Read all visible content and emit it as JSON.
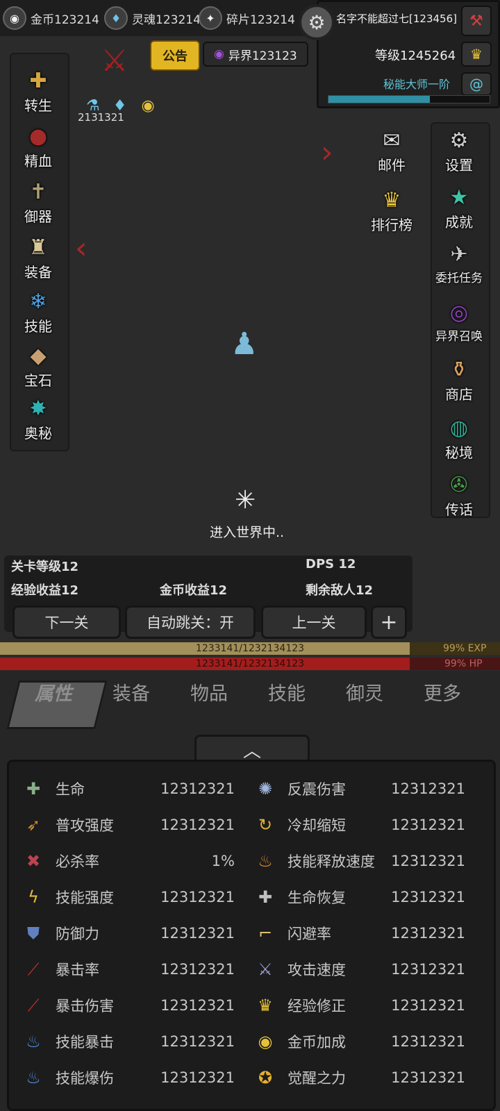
{
  "topbar": {
    "gold_label": "金币123214",
    "soul_label": "灵魂123214",
    "shard_label": "碎片123214",
    "player_name": "名字不能超过七[123456]",
    "level": "等级1245264",
    "title": "秘能大师一阶"
  },
  "notice": {
    "label": "公告",
    "other_world": "异界123123"
  },
  "buff_value": "2131321",
  "left_menu": [
    "转生",
    "精血",
    "御器",
    "装备",
    "技能",
    "宝石",
    "奥秘"
  ],
  "right_menu": [
    "设置",
    "成就",
    "委托任务",
    "异界召唤",
    "商店",
    "秘境",
    "传话"
  ],
  "mid_menu": [
    "邮件",
    "排行榜"
  ],
  "loading_text": "进入世界中..",
  "stage": {
    "level": "关卡等级12",
    "dps": "DPS 12",
    "exp_income": "经验收益12",
    "gold_income": "金币收益12",
    "enemies_left": "剩余敌人12"
  },
  "buttons": {
    "next": "下一关",
    "auto": "自动跳关：开",
    "prev": "上一关",
    "plus": "+"
  },
  "bars": {
    "exp_text": "1233141/1232134123",
    "exp_percent": "99% EXP",
    "exp_fill": 0.82,
    "hp_text": "1233141/1232134123",
    "hp_percent": "99%   HP",
    "hp_fill": 0.82
  },
  "tabs": [
    "属性",
    "装备",
    "物品",
    "技能",
    "御灵",
    "更多"
  ],
  "stats": [
    {
      "name": "生命",
      "value": "12312321",
      "icon": "plus-icon"
    },
    {
      "name": "反震伤害",
      "value": "12312321",
      "icon": "burst-icon"
    },
    {
      "name": "普攻强度",
      "value": "12312321",
      "icon": "arrow-icon"
    },
    {
      "name": "冷却缩短",
      "value": "12312321",
      "icon": "swirl-icon"
    },
    {
      "name": "必杀率",
      "value": "1%",
      "icon": "crit-icon"
    },
    {
      "name": "技能释放速度",
      "value": "12312321",
      "icon": "flame-icon"
    },
    {
      "name": "技能强度",
      "value": "12312321",
      "icon": "bolt-icon"
    },
    {
      "name": "生命恢复",
      "value": "12312321",
      "icon": "heal-icon"
    },
    {
      "name": "防御力",
      "value": "12312321",
      "icon": "shield-icon"
    },
    {
      "name": "闪避率",
      "value": "12312321",
      "icon": "boot-icon"
    },
    {
      "name": "暴击率",
      "value": "12312321",
      "icon": "slash-icon"
    },
    {
      "name": "攻击速度",
      "value": "12312321",
      "icon": "sword-icon"
    },
    {
      "name": "暴击伤害",
      "value": "12312321",
      "icon": "slash-icon"
    },
    {
      "name": "经验修正",
      "value": "12312321",
      "icon": "crown-icon"
    },
    {
      "name": "技能暴击",
      "value": "12312321",
      "icon": "blue-flame-icon"
    },
    {
      "name": "金币加成",
      "value": "12312321",
      "icon": "coin-icon"
    },
    {
      "name": "技能爆伤",
      "value": "12312321",
      "icon": "blue-flame-icon"
    },
    {
      "name": "觉醒之力",
      "value": "12312321",
      "icon": "star-badge-icon"
    }
  ]
}
